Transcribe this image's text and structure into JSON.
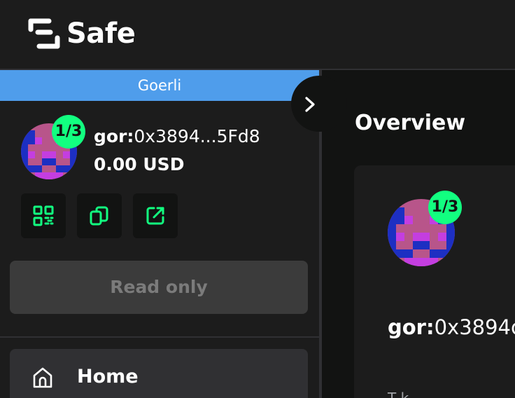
{
  "brand": {
    "name": "Safe"
  },
  "network": {
    "label": "Goerli",
    "color": "#4f9deb"
  },
  "safe": {
    "threshold": "1/3",
    "prefix": "gor:",
    "address_short": "0x3894...5Fd8",
    "balance": "0.00 USD"
  },
  "actions": {
    "qr_icon": "qr-code-icon",
    "copy_icon": "copy-icon",
    "explorer_icon": "external-link-icon",
    "expand_icon": "chevron-right-icon"
  },
  "read_only_label": "Read only",
  "nav": {
    "items": [
      {
        "label": "Home",
        "icon": "home-icon"
      }
    ]
  },
  "overview": {
    "title": "Overview",
    "threshold": "1/3",
    "prefix": "gor:",
    "address_partial": "0x3894c",
    "label_partial": "T k"
  },
  "colors": {
    "accent": "#12ff80",
    "background": "#121312",
    "panel": "#1c1c1c",
    "network": "#4f9deb"
  }
}
